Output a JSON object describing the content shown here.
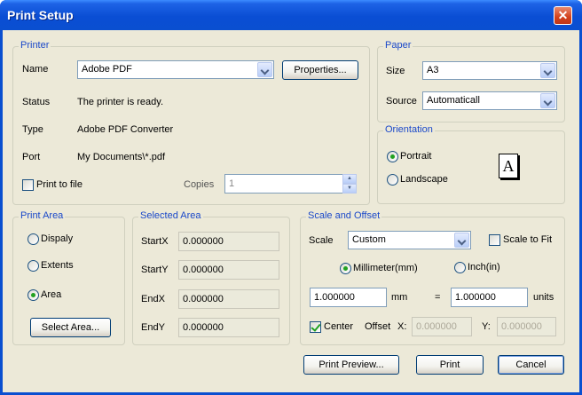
{
  "window": {
    "title": "Print Setup",
    "close_glyph": "✕"
  },
  "printer": {
    "legend": "Printer",
    "name_label": "Name",
    "name_value": "Adobe PDF",
    "properties_label": "Properties...",
    "status_label": "Status",
    "status_value": "The printer is ready.",
    "type_label": "Type",
    "type_value": "Adobe PDF Converter",
    "port_label": "Port",
    "port_value": "My Documents\\*.pdf",
    "print_to_file_label": "Print to file",
    "print_to_file_checked": false,
    "copies_label": "Copies",
    "copies_value": "1"
  },
  "paper": {
    "legend": "Paper",
    "size_label": "Size",
    "size_value": "A3",
    "source_label": "Source",
    "source_value": "Automaticall"
  },
  "orientation": {
    "legend": "Orientation",
    "portrait_label": "Portrait",
    "landscape_label": "Landscape",
    "selected": "Portrait",
    "page_glyph": "A"
  },
  "print_area": {
    "legend": "Print Area",
    "display_label": "Dispaly",
    "extents_label": "Extents",
    "area_label": "Area",
    "selected": "Area",
    "select_area_label": "Select Area..."
  },
  "selected_area": {
    "legend": "Selected Area",
    "startx_label": "StartX",
    "startx_value": "0.000000",
    "starty_label": "StartY",
    "starty_value": "0.000000",
    "endx_label": "EndX",
    "endx_value": "0.000000",
    "endy_label": "EndY",
    "endy_value": "0.000000"
  },
  "scale": {
    "legend": "Scale and Offset",
    "scale_label": "Scale",
    "scale_value": "Custom",
    "scale_to_fit_label": "Scale to Fit",
    "scale_to_fit_checked": false,
    "millimeter_label": "Millimeter(mm)",
    "inch_label": "Inch(in)",
    "unit_selected": "Millimeter(mm)",
    "mm_value": "1.000000",
    "mm_label": "mm",
    "equals": "=",
    "units_value": "1.000000",
    "units_label": "units",
    "center_label": "Center",
    "center_checked": true,
    "offset_label": "Offset",
    "x_label": "X:",
    "x_value": "0.000000",
    "y_label": "Y:",
    "y_value": "0.000000"
  },
  "buttons": {
    "print_preview": "Print Preview...",
    "print": "Print",
    "cancel": "Cancel"
  }
}
